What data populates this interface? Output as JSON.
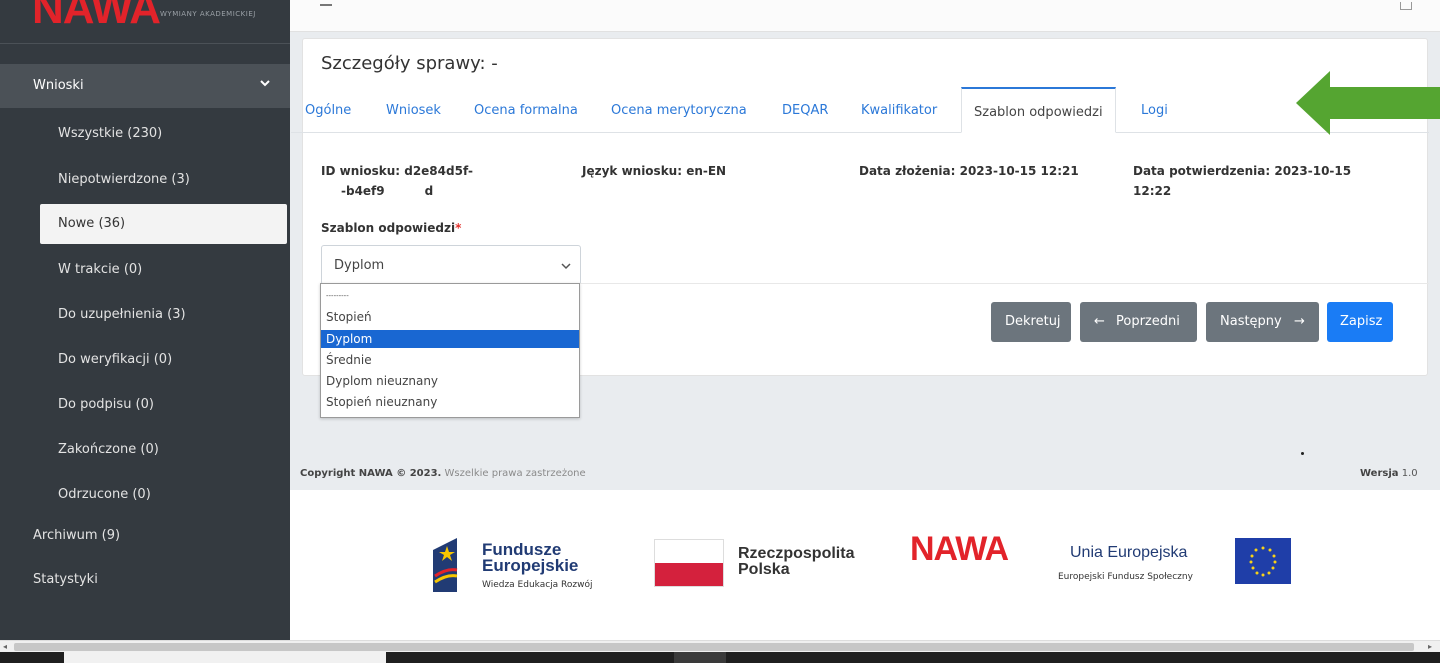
{
  "brand": {
    "logo": "NAWA",
    "subtitle": "WYMIANY AKADEMICKIEJ"
  },
  "sidebar": {
    "group_label": "Wnioski",
    "items": [
      {
        "label": "Wszystkie (230)"
      },
      {
        "label": "Niepotwierdzone (3)"
      },
      {
        "label": "Nowe (36)"
      },
      {
        "label": "W trakcie (0)"
      },
      {
        "label": "Do uzupełnienia (3)"
      },
      {
        "label": "Do weryfikacji (0)"
      },
      {
        "label": "Do podpisu (0)"
      },
      {
        "label": "Zakończone (0)"
      },
      {
        "label": "Odrzucone (0)"
      }
    ],
    "active_item": "Nowe (36)",
    "archive_label": "Archiwum (9)",
    "stats_label": "Statystyki"
  },
  "main": {
    "title": "Szczegóły sprawy: -",
    "tabs": [
      {
        "label": "Ogólne"
      },
      {
        "label": "Wniosek"
      },
      {
        "label": "Ocena formalna"
      },
      {
        "label": "Ocena merytoryczna"
      },
      {
        "label": "DEQAR"
      },
      {
        "label": "Kwalifikator"
      },
      {
        "label": "Szablon odpowiedzi"
      },
      {
        "label": "Logi"
      }
    ],
    "active_tab": "Szablon odpowiedzi",
    "info": {
      "id_line1": "ID wniosku: d2e84d5f-",
      "id_line2": "-b4ef9",
      "id_line2_end": "d",
      "lang": "Język wniosku: en-EN",
      "date_submitted": "Data złożenia: 2023-10-15 12:21",
      "date_confirmed_line1": "Data potwierdzenia: 2023-10-15",
      "date_confirmed_line2": "12:22"
    },
    "template_field": {
      "label": "Szablon odpowiedzi",
      "required_mark": "*",
      "value": "Dyplom",
      "options": [
        "---------",
        "Stopień",
        "Dyplom",
        "Średnie",
        "Dyplom nieuznany",
        "Stopień nieuznany"
      ],
      "selected": "Dyplom"
    },
    "buttons": {
      "dekretuj": "Dekretuj",
      "prev": "Poprzedni",
      "next": "Następny",
      "save": "Zapisz"
    }
  },
  "footer": {
    "copyright_bold": "Copyright NAWA © 2023.",
    "copyright_rest": "Wszelkie prawa zastrzeżone",
    "version_label": "Wersja",
    "version_value": "1.0"
  },
  "logos": {
    "fe_line1": "Fundusze",
    "fe_line2": "Europejskie",
    "fe_sub": "Wiedza Edukacja Rozwój",
    "pl_line1": "Rzeczpospolita",
    "pl_line2": "Polska",
    "nawa": "NAWA",
    "ue_title": "Unia Europejska",
    "ue_sub": "Europejski Fundusz Społeczny"
  },
  "colors": {
    "sidebar_bg": "#343a40",
    "accent": "#1a7cf5",
    "arrow": "#55a531",
    "brand_red": "#e2232a"
  }
}
